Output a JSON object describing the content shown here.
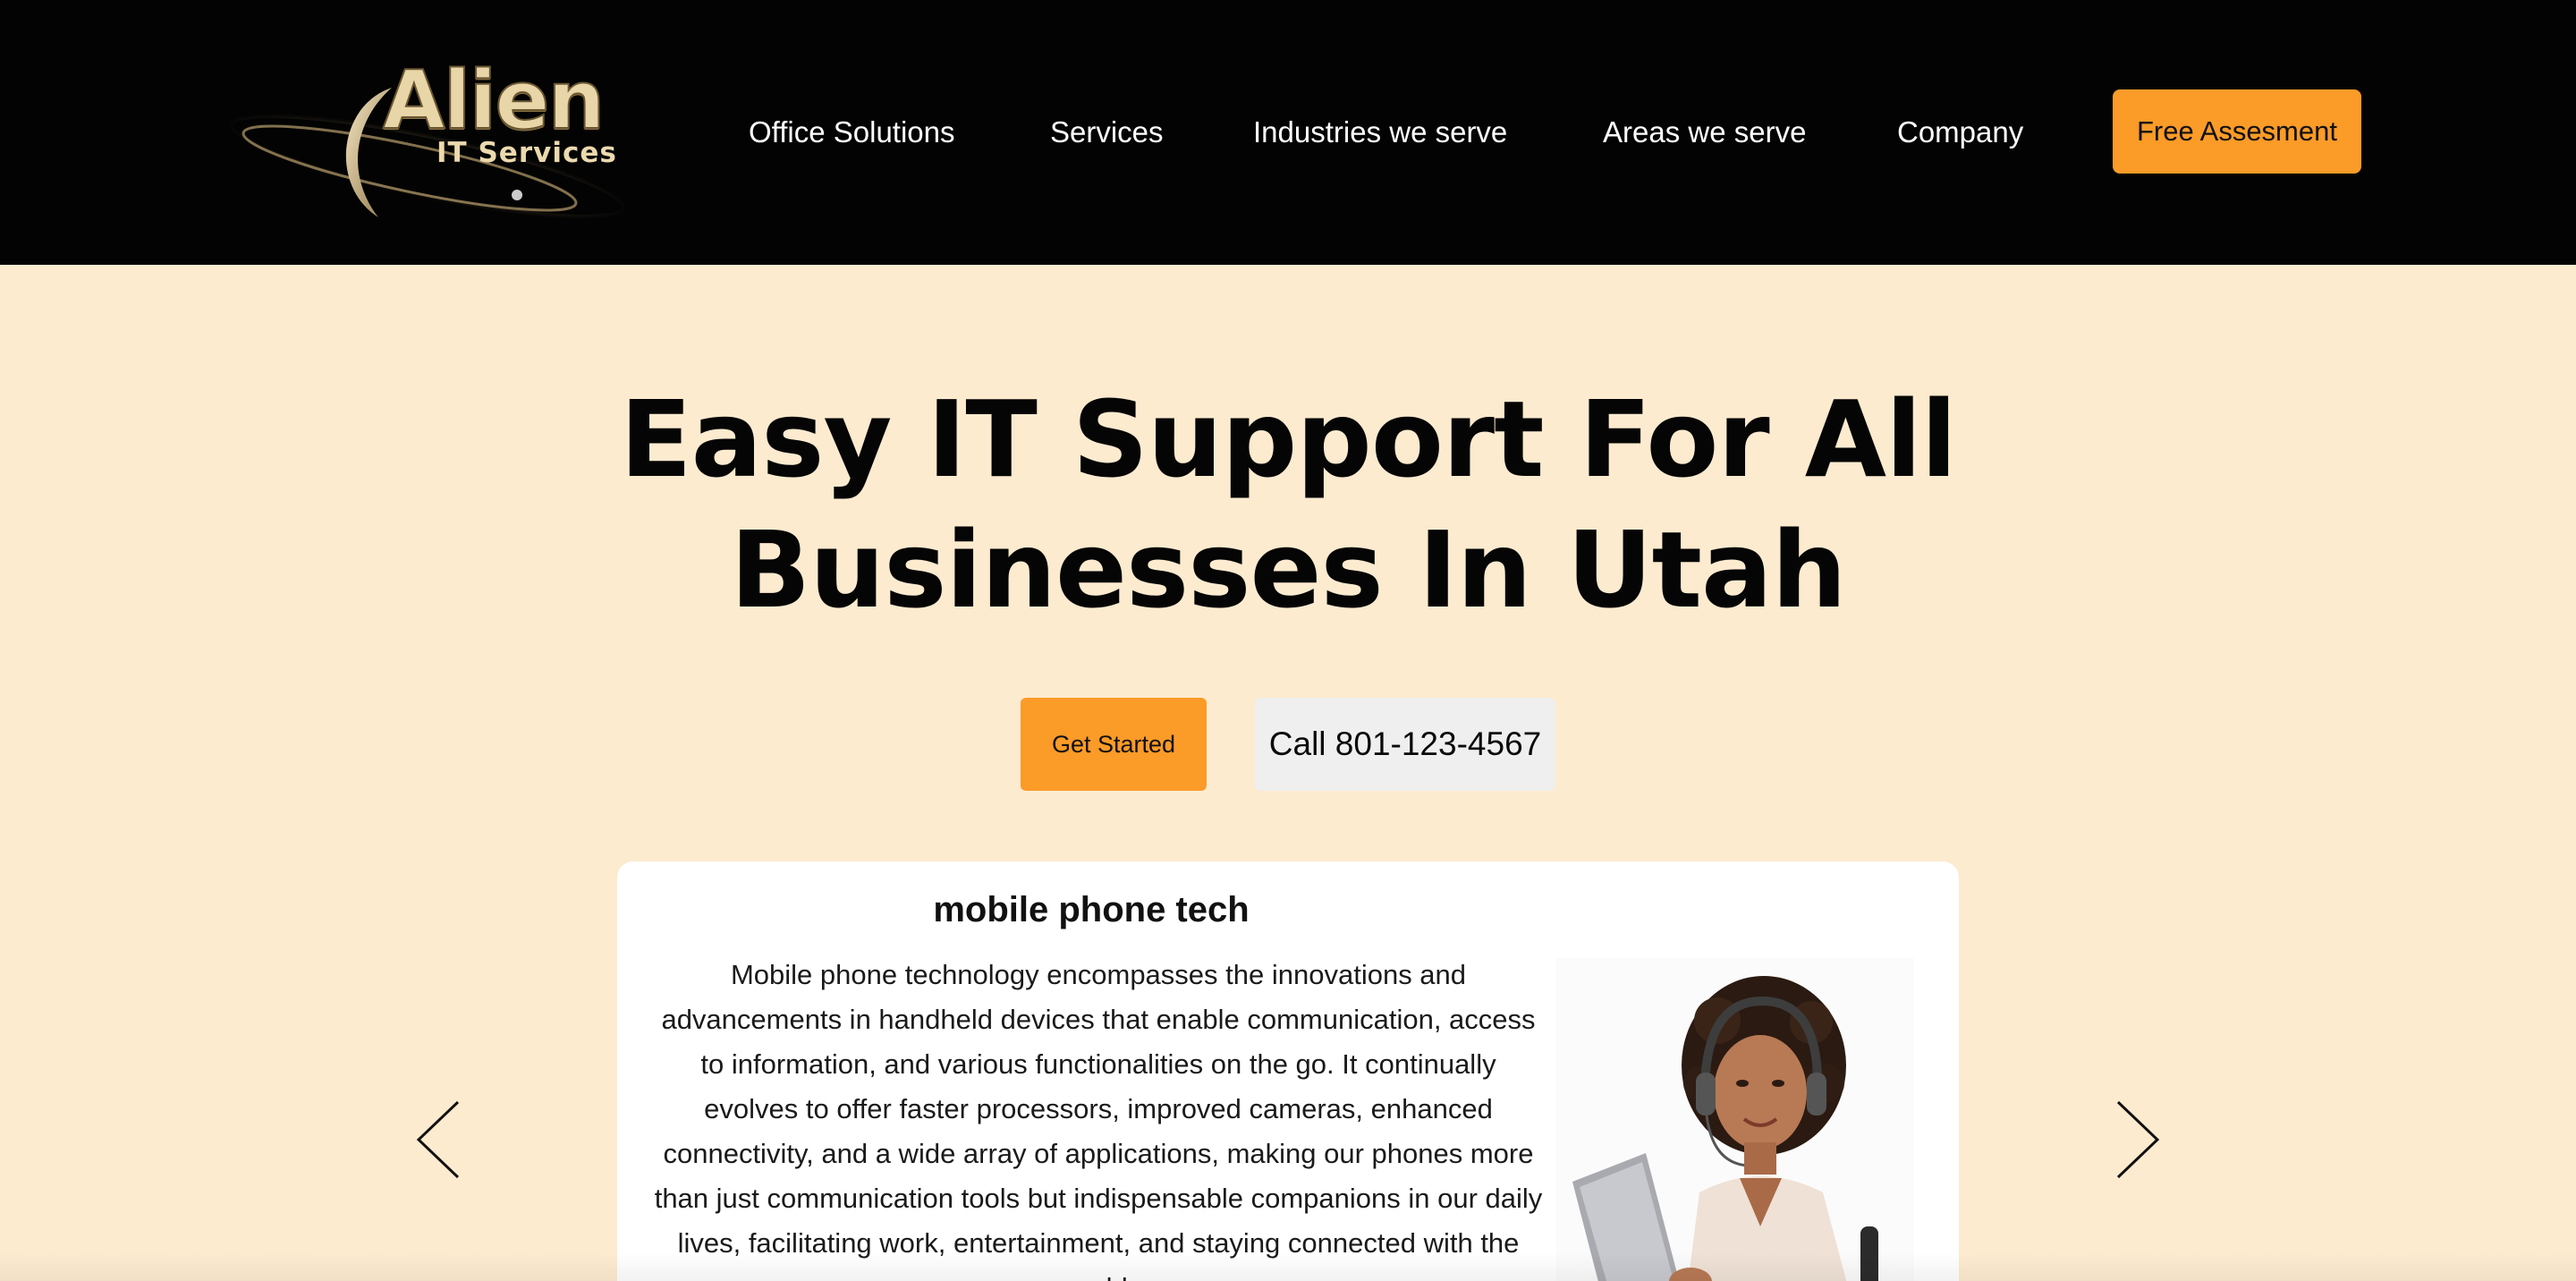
{
  "header": {
    "logo": {
      "icon": "alien-planet-ring-logo",
      "word": "Alien",
      "sub": "IT Services"
    },
    "nav": [
      {
        "label": "Office Solutions"
      },
      {
        "label": "Services"
      },
      {
        "label": "Industries we serve"
      },
      {
        "label": "Areas we serve"
      },
      {
        "label": "Company"
      }
    ],
    "cta_label": "Free Assesment"
  },
  "hero": {
    "title_line1": "Easy IT Support For All",
    "title_line2": "Businesses In Utah",
    "primary_button": "Get Started",
    "secondary_button": "Call 801-123-4567"
  },
  "carousel": {
    "prev_icon": "chevron-left-icon",
    "next_icon": "chevron-right-icon",
    "card": {
      "title": "mobile phone tech",
      "text": "Mobile phone technology encompasses the innovations and advancements in handheld devices that enable communication, access to information, and various functionalities on the go. It continually evolves to offer faster processors, improved cameras, enhanced connectivity, and a wide array of applications, making our phones more than just communication tools but indispensable companions in our daily lives, facilitating work, entertainment, and staying connected with the world.",
      "image": "woman-with-headset-using-laptop-illustration"
    }
  },
  "colors": {
    "header_bg": "#030303",
    "page_bg": "#fdebd0",
    "accent": "#fb9b28",
    "secondary_button_bg": "#efefef",
    "card_bg": "#ffffff"
  }
}
